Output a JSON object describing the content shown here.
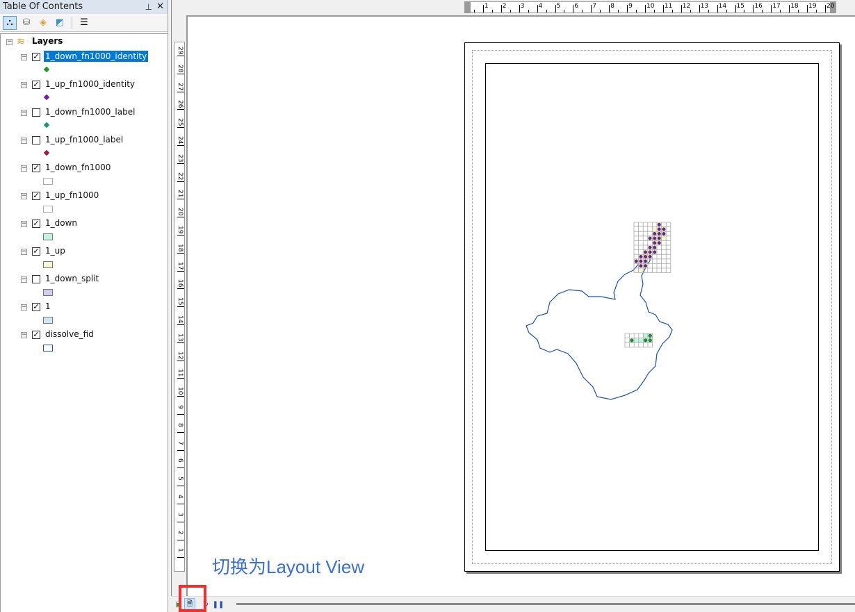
{
  "toc": {
    "title": "Table Of Contents",
    "root": "Layers",
    "layers": [
      {
        "name": "1_down_fn1000_identity",
        "checked": true,
        "selected": true,
        "symbol": "point",
        "color": "#1a9a1a"
      },
      {
        "name": "1_up_fn1000_identity",
        "checked": true,
        "symbol": "point",
        "color": "#7a1aa0"
      },
      {
        "name": "1_down_fn1000_label",
        "checked": false,
        "symbol": "point",
        "color": "#1a9a6a"
      },
      {
        "name": "1_up_fn1000_label",
        "checked": false,
        "symbol": "point",
        "color": "#a01a3a"
      },
      {
        "name": "1_down_fn1000",
        "checked": true,
        "symbol": "polygon",
        "color": "#ffffff",
        "outline": "#aaaaaa"
      },
      {
        "name": "1_up_fn1000",
        "checked": true,
        "symbol": "polygon",
        "color": "#ffffff",
        "outline": "#aaaaaa"
      },
      {
        "name": "1_down",
        "checked": true,
        "symbol": "polygon",
        "color": "#c0f5e0",
        "outline": "#777777"
      },
      {
        "name": "1_up",
        "checked": true,
        "symbol": "polygon",
        "color": "#f5f8d0",
        "outline": "#777777"
      },
      {
        "name": "1_down_split",
        "checked": false,
        "symbol": "polygon",
        "color": "#d4ccf0",
        "outline": "#777777"
      },
      {
        "name": "1",
        "checked": true,
        "symbol": "polygon",
        "color": "#d0e8f5",
        "outline": "#777777"
      },
      {
        "name": "dissolve_fid",
        "checked": true,
        "symbol": "polygon",
        "color": "#ffffff",
        "outline": "#1a50b0"
      }
    ]
  },
  "rulers": {
    "horizontal": [
      "1",
      "2",
      "3",
      "4",
      "5",
      "6",
      "7",
      "8",
      "9",
      "10",
      "11",
      "12",
      "13",
      "14",
      "15",
      "16",
      "17",
      "18",
      "19",
      "20"
    ],
    "vertical": [
      "29",
      "28",
      "27",
      "26",
      "25",
      "24",
      "23",
      "22",
      "21",
      "20",
      "19",
      "18",
      "17",
      "16",
      "15",
      "14",
      "13",
      "12",
      "11",
      "10",
      "9",
      "8",
      "7",
      "6",
      "5",
      "4",
      "3",
      "2",
      "1"
    ]
  },
  "annotation": "切换为Layout View",
  "colors": {
    "boundary": "#1a50b0",
    "highlight": "#f03030",
    "annotation": "#3a6fd8"
  }
}
